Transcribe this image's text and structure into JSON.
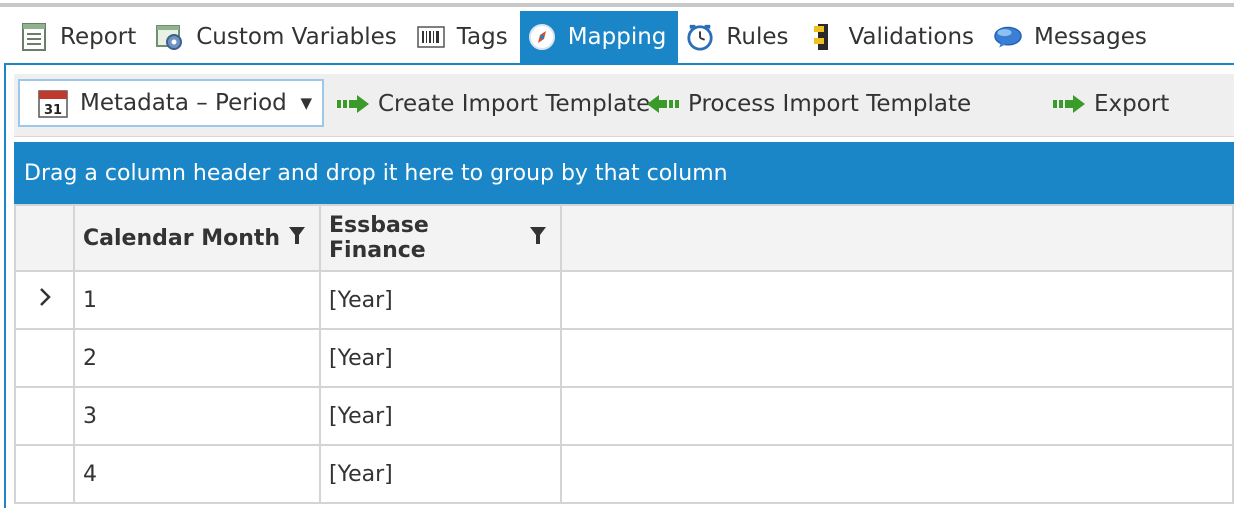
{
  "tabs": [
    {
      "label": "Report",
      "icon": "report-icon",
      "active": false
    },
    {
      "label": "Custom Variables",
      "icon": "custom-variables-icon",
      "active": false
    },
    {
      "label": "Tags",
      "icon": "barcode-icon",
      "active": false
    },
    {
      "label": "Mapping",
      "icon": "compass-icon",
      "active": true
    },
    {
      "label": "Rules",
      "icon": "clock-icon",
      "active": false
    },
    {
      "label": "Validations",
      "icon": "validations-icon",
      "active": false
    },
    {
      "label": "Messages",
      "icon": "speech-bubble-icon",
      "active": false
    }
  ],
  "toolbar": {
    "selector_label": "Metadata – Period",
    "create_label": "Create Import Template",
    "process_label": "Process Import Template",
    "export_label": "Export",
    "calendar_day": "31"
  },
  "group_bar": "Drag a column header and drop it here to group by that column",
  "grid": {
    "columns": [
      "Calendar Month",
      "Essbase Finance"
    ],
    "rows": [
      {
        "month": "1",
        "essbase": "[Year]"
      },
      {
        "month": "2",
        "essbase": "[Year]"
      },
      {
        "month": "3",
        "essbase": "[Year]"
      },
      {
        "month": "4",
        "essbase": "[Year]"
      }
    ]
  },
  "colors": {
    "accent": "#1a86c8",
    "header_bg": "#f3f3f3",
    "toolbar_bg": "#efefef"
  }
}
